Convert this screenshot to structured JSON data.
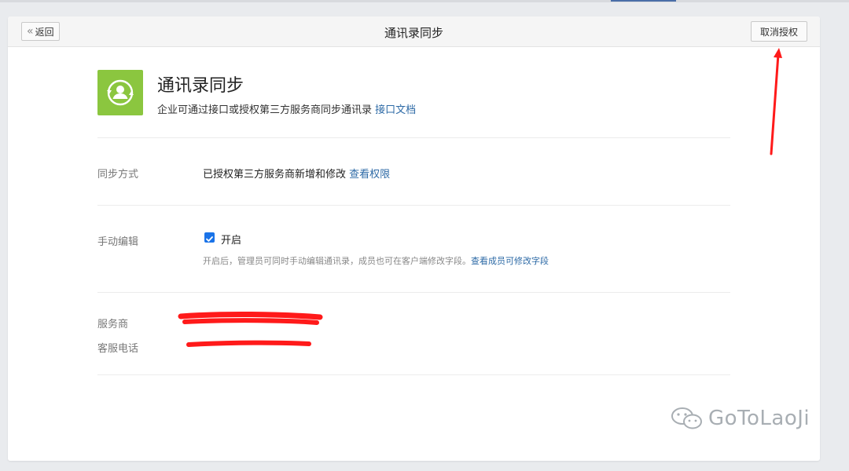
{
  "header": {
    "back_label": "返回",
    "title": "通讯录同步",
    "revoke_label": "取消授权"
  },
  "app": {
    "title": "通讯录同步",
    "description": "企业可通过接口或授权第三方服务商同步通讯录",
    "doc_link": "接口文档",
    "icon": "contact-sync-icon",
    "icon_color": "#8bc63f"
  },
  "sync_mode": {
    "label": "同步方式",
    "value": "已授权第三方服务商新增和修改",
    "link": "查看权限"
  },
  "manual_edit": {
    "label": "手动编辑",
    "checked": true,
    "checkbox_label": "开启",
    "hint": "开启后，管理员可同时手动编辑通讯录，成员也可在客户端修改字段。",
    "hint_link": "查看成员可修改字段"
  },
  "provider": {
    "name_label": "服务商",
    "phone_label": "客服电话"
  },
  "watermark": {
    "text": "GoToLaoJi"
  },
  "colors": {
    "link": "#2d6aa6",
    "checkbox": "#1a73e8",
    "annotation_red": "#ff1a1a"
  }
}
